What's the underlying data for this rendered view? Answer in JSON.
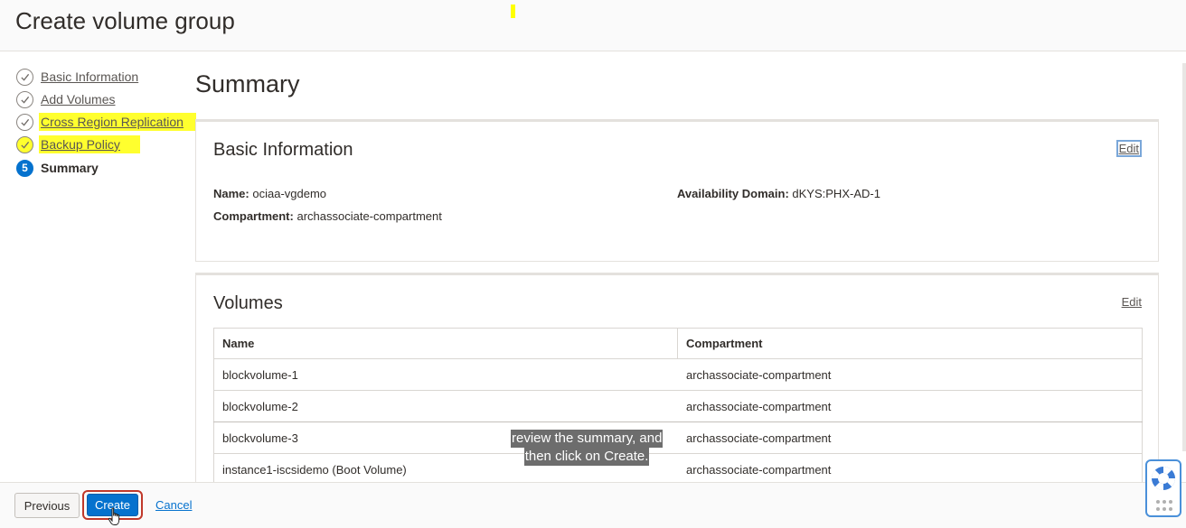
{
  "header": {
    "title": "Create volume group"
  },
  "steps": [
    {
      "number": "1",
      "label": "Basic Information",
      "state": "complete",
      "highlighted": false
    },
    {
      "number": "2",
      "label": "Add Volumes",
      "state": "complete",
      "highlighted": false
    },
    {
      "number": "3",
      "label": "Cross Region Replication",
      "state": "complete",
      "highlighted": true
    },
    {
      "number": "4",
      "label": "Backup Policy",
      "state": "complete",
      "highlighted": true
    },
    {
      "number": "5",
      "label": "Summary",
      "state": "current",
      "highlighted": false
    }
  ],
  "summary": {
    "title": "Summary",
    "basic": {
      "title": "Basic Information",
      "edit_label": "Edit",
      "name_label": "Name:",
      "name_value": "ociaa-vgdemo",
      "compartment_label": "Compartment:",
      "compartment_value": "archassociate-compartment",
      "ad_label": "Availability Domain:",
      "ad_value": "dKYS:PHX-AD-1"
    },
    "volumes": {
      "title": "Volumes",
      "edit_label": "Edit",
      "columns": [
        "Name",
        "Compartment"
      ],
      "rows": [
        [
          "blockvolume-1",
          "archassociate-compartment"
        ],
        [
          "blockvolume-2",
          "archassociate-compartment"
        ],
        [
          "blockvolume-3",
          "archassociate-compartment"
        ],
        [
          "instance1-iscsidemo (Boot Volume)",
          "archassociate-compartment"
        ]
      ]
    }
  },
  "caption": {
    "line1": "review the summary, and",
    "line2": "then click on Create."
  },
  "footer": {
    "previous_label": "Previous",
    "create_label": "Create",
    "cancel_label": "Cancel"
  },
  "colors": {
    "primary": "#0572ce",
    "highlight": "#ffff2e",
    "annotation": "#c0392b"
  },
  "icons": [
    "check-icon",
    "lifebuoy-icon",
    "grip-icon",
    "hand-cursor-icon"
  ]
}
